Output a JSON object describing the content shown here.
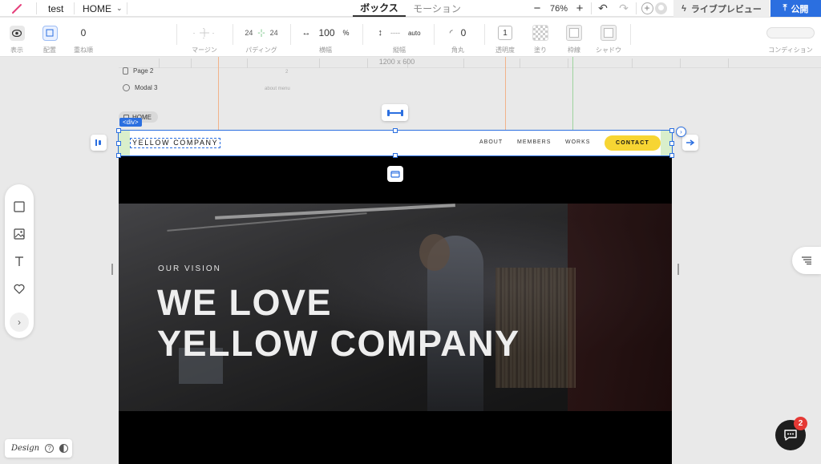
{
  "topbar": {
    "project_name": "test",
    "page_select": "HOME",
    "tabs": [
      {
        "label": "ボックス",
        "active": true
      },
      {
        "label": "モーション",
        "active": false
      }
    ],
    "zoom_minus": "−",
    "zoom_value": "76%",
    "zoom_plus": "+",
    "live_preview": "ライブプレビュー",
    "publish": "公開"
  },
  "properties": {
    "display_label": "表示",
    "layout_label": "配置",
    "z_index": "0",
    "z_index_label": "重ね順",
    "margin_label": "マージン",
    "padding_left": "24",
    "padding_right": "24",
    "padding_label": "パディング",
    "width_value": "100",
    "width_unit": "%",
    "width_label": "横幅",
    "height_value": "----",
    "height_unit": "auto",
    "height_label": "縦幅",
    "radius_value": "0",
    "radius_label": "角丸",
    "opacity_value": "1",
    "opacity_label": "透明度",
    "fill_label": "塗り",
    "border_label": "枠線",
    "shadow_label": "シャドウ",
    "condition_label": "コンディション"
  },
  "canvas": {
    "page_dimensions": "1200 x 600",
    "page_list": [
      "Page 2",
      "Modal 3"
    ],
    "small_label_1": "about menu",
    "small_label_2": "2",
    "home_chip": "HOME",
    "selection_tag": "<div>"
  },
  "site": {
    "logo": "YELLOW COMPANY",
    "nav": [
      "ABOUT",
      "MEMBERS",
      "WORKS"
    ],
    "contact": "CONTACT",
    "hero_eyebrow": "OUR VISION",
    "hero_title_line1": "WE LOVE",
    "hero_title_line2": "YELLOW COMPANY"
  },
  "bottom": {
    "design_label": "Design",
    "help": "?",
    "chat_badge": "2"
  },
  "colors": {
    "accent_blue": "#2b6fe0",
    "contact_yellow": "#f7d533",
    "badge_red": "#e53935"
  }
}
